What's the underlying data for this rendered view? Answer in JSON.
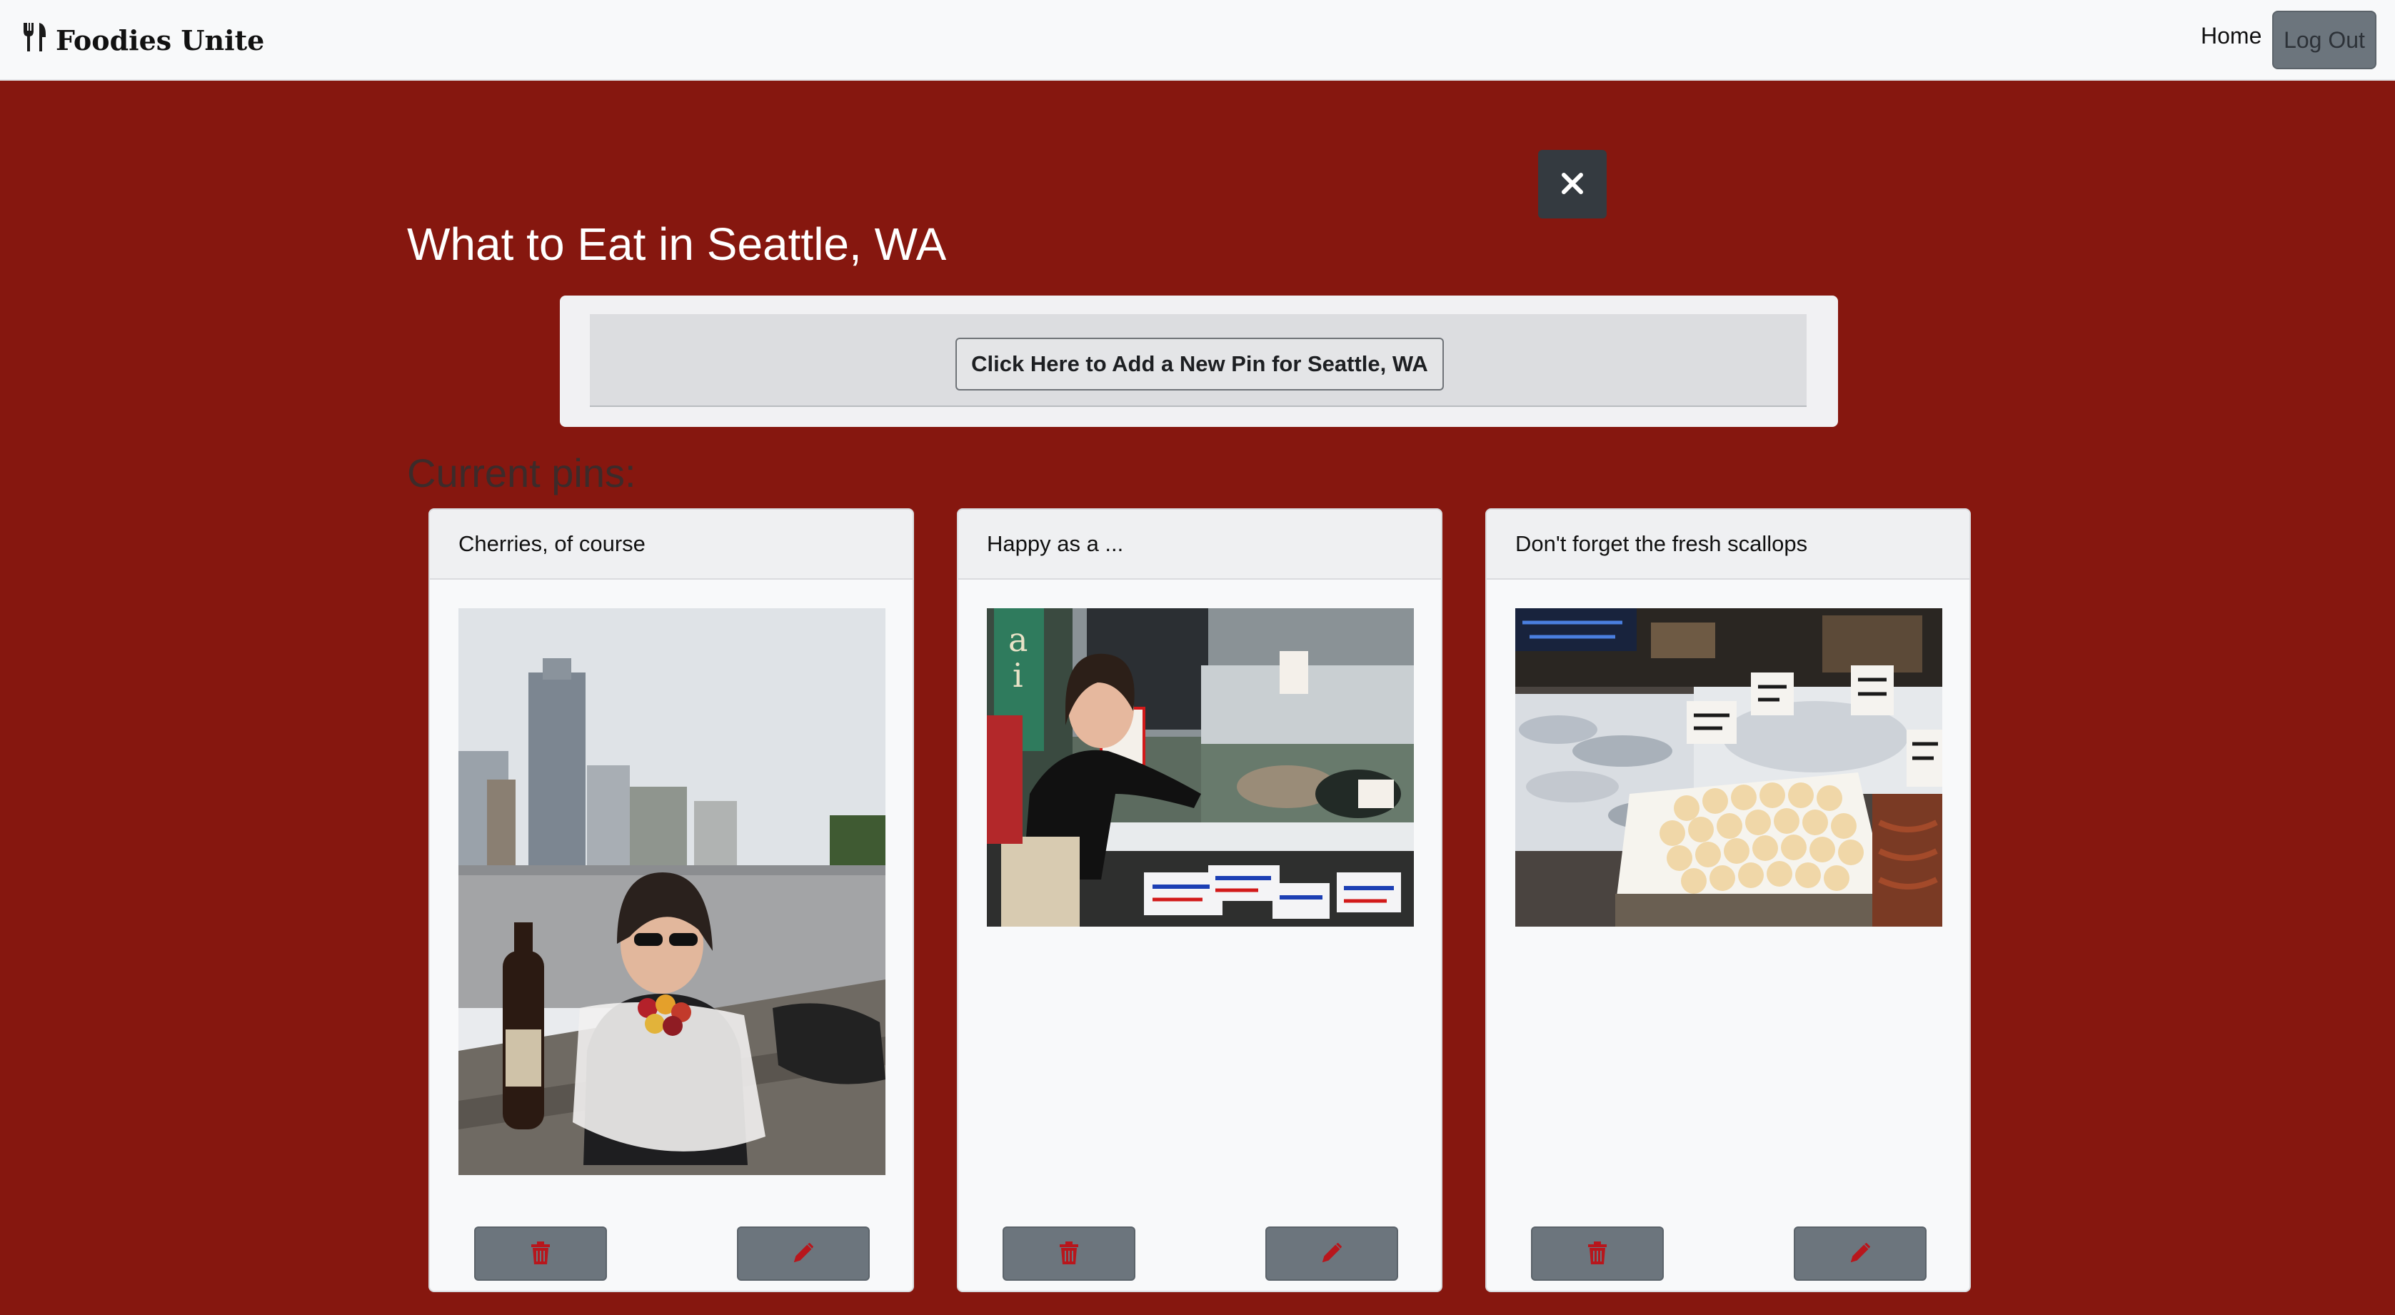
{
  "navbar": {
    "brand": "Foodies Unite",
    "brand_icon": "utensils-icon",
    "home_label": "Home",
    "logout_label": "Log Out"
  },
  "page": {
    "title": "What to Eat in Seattle, WA",
    "close_icon": "close-icon",
    "add_pin_label": "Click Here to Add a New Pin for Seattle, WA",
    "section_heading": "Current pins:"
  },
  "pins": [
    {
      "title": "Cherries, of course",
      "photo": "woman holding bag of cherries at picnic table with city skyline",
      "delete_icon": "trash-icon",
      "edit_icon": "pencil-icon"
    },
    {
      "title": "Happy as a ...",
      "photo": "woman pointing at clams in seafood market case",
      "delete_icon": "trash-icon",
      "edit_icon": "pencil-icon"
    },
    {
      "title": "Don't forget the fresh scallops",
      "photo": "seafood market display with scallops, fish and lobsters",
      "delete_icon": "trash-icon",
      "edit_icon": "pencil-icon"
    }
  ],
  "colors": {
    "background": "#86170f",
    "navbar": "#f8f9fa",
    "button_gray": "#6c757d",
    "icon_red": "#b8161c",
    "close_button": "#343a40"
  }
}
